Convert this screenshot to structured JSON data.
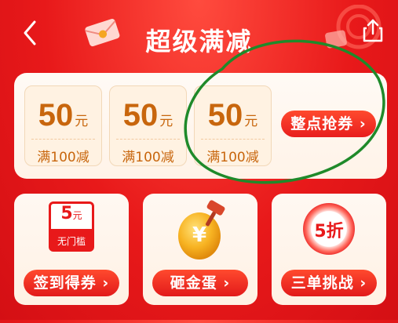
{
  "header": {
    "title": "超级满减"
  },
  "coupons": [
    {
      "amount": "50",
      "unit": "元",
      "condition": "满100减"
    },
    {
      "amount": "50",
      "unit": "元",
      "condition": "满100减"
    },
    {
      "amount": "50",
      "unit": "元",
      "condition": "满100减"
    }
  ],
  "grab_button": "整点抢券 ›",
  "cards": [
    {
      "button": "签到得券 ›",
      "icon": "no-threshold-coupon-icon",
      "icon_amount": "5",
      "icon_unit": "元",
      "icon_text": "无门槛"
    },
    {
      "button": "砸金蛋 ›",
      "icon": "golden-egg-icon",
      "icon_text": "¥"
    },
    {
      "button": "三单挑战 ›",
      "icon": "discount-badge-icon",
      "icon_text": "5折"
    }
  ],
  "colors": {
    "primary_red": "#e8191a",
    "coupon_text": "#c8660d",
    "annotation": "#1f8a2a"
  }
}
